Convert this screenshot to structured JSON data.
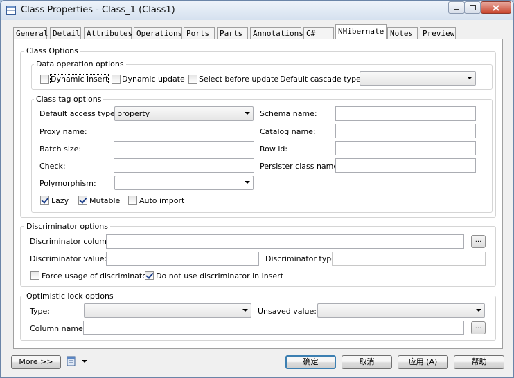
{
  "window": {
    "title": "Class Properties - Class_1 (Class1)"
  },
  "tabs": [
    {
      "label": "General"
    },
    {
      "label": "Detail"
    },
    {
      "label": "Attributes"
    },
    {
      "label": "Operations"
    },
    {
      "label": "Ports"
    },
    {
      "label": "Parts"
    },
    {
      "label": "Annotations"
    },
    {
      "label": "C#"
    },
    {
      "label": "NHibernate",
      "active": true
    },
    {
      "label": "Notes"
    },
    {
      "label": "Preview"
    }
  ],
  "class_options": {
    "title": "Class Options",
    "data_operation": {
      "title": "Data operation options",
      "dynamic_insert": {
        "label": "Dynamic insert",
        "checked": false
      },
      "dynamic_update": {
        "label": "Dynamic update",
        "checked": false
      },
      "select_before_update": {
        "label": "Select before update",
        "checked": false
      },
      "default_cascade_label": "Default cascade type:",
      "default_cascade_value": ""
    },
    "class_tag": {
      "title": "Class tag options",
      "default_access_label": "Default access type:",
      "default_access_value": "property",
      "proxy_label": "Proxy name:",
      "batch_label": "Batch size:",
      "check_label": "Check:",
      "polymorphism_label": "Polymorphism:",
      "polymorphism_value": "",
      "schema_label": "Schema name:",
      "catalog_label": "Catalog name:",
      "rowid_label": "Row id:",
      "persister_label": "Persister class name:",
      "lazy": {
        "label": "Lazy",
        "checked": true
      },
      "mutable": {
        "label": "Mutable",
        "checked": true
      },
      "auto_import": {
        "label": "Auto import",
        "checked": false
      }
    }
  },
  "discriminator": {
    "title": "Discriminator options",
    "column_label": "Discriminator column:",
    "value_label": "Discriminator value:",
    "type_label": "Discriminator type:",
    "force_usage": {
      "label": "Force usage of discriminator",
      "checked": false
    },
    "do_not_use": {
      "label": "Do not use discriminator in insert",
      "checked": true
    },
    "ellipsis": "..."
  },
  "optimistic_lock": {
    "title": "Optimistic lock options",
    "type_label": "Type:",
    "type_value": "",
    "unsaved_label": "Unsaved value:",
    "unsaved_value": "",
    "column_label": "Column name:",
    "ellipsis": "..."
  },
  "footer": {
    "more_label": "More >>",
    "ok_label": "确定",
    "cancel_label": "取消",
    "apply_label": "应用 (A)",
    "help_label": "帮助"
  },
  "colors": {
    "accent": "#3c7fb1",
    "check": "#1c3f8b"
  }
}
